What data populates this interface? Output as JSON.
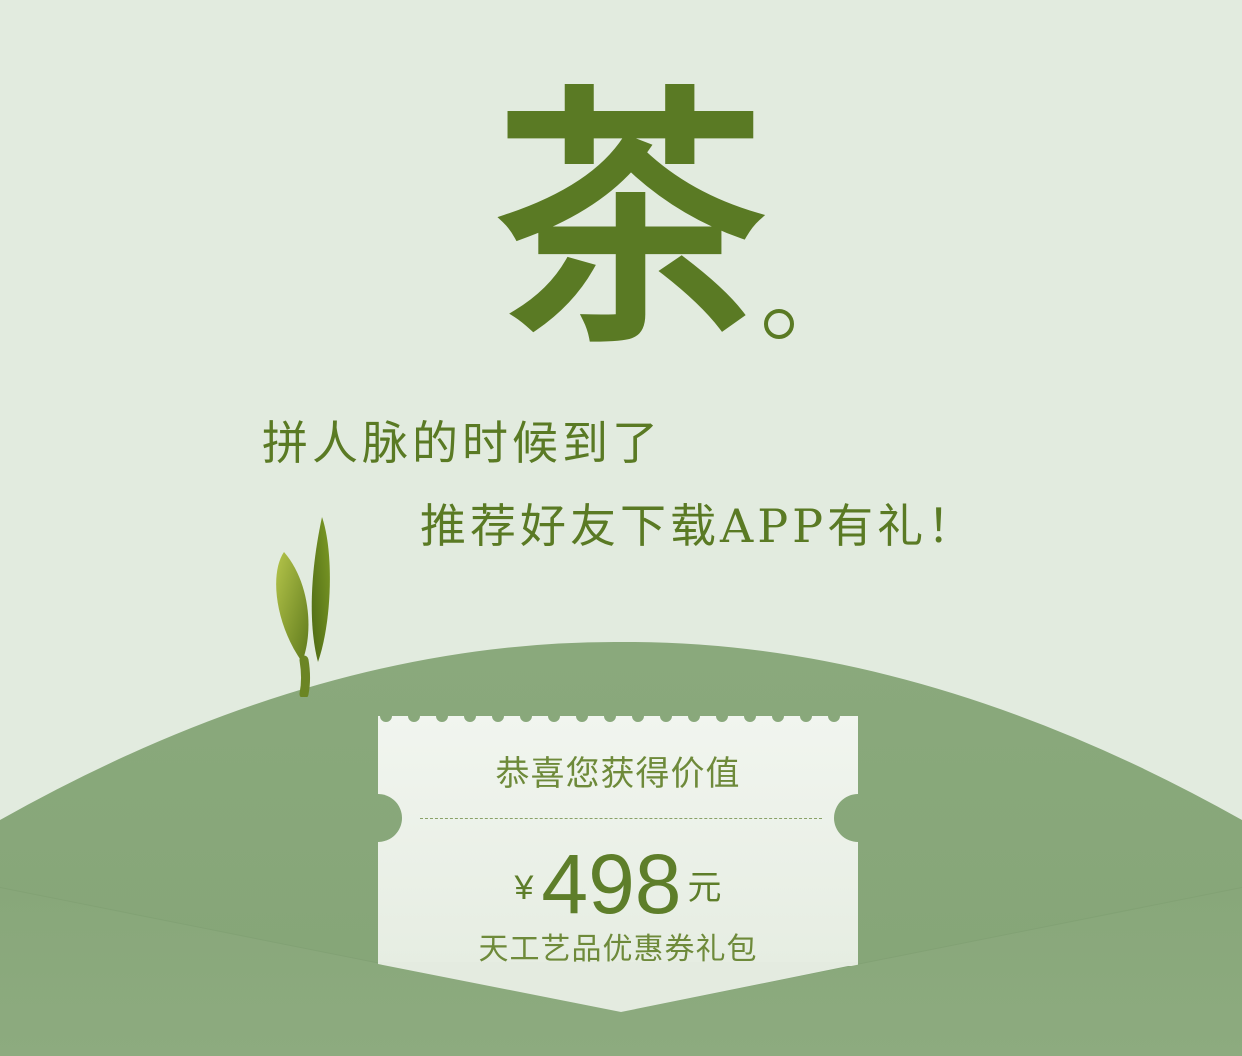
{
  "hero": {
    "character": "茶",
    "slogan_line1": "拼人脉的时候到了",
    "slogan_line2": "推荐好友下载APP有礼！"
  },
  "coupon": {
    "title": "恭喜您获得价值",
    "currency": "¥",
    "amount": "498",
    "unit": "元",
    "subtitle": "天工艺品优惠券礼包"
  },
  "colors": {
    "background": "#e2ebdf",
    "hill": "#8aa97c",
    "accent_green": "#5a7a24",
    "coupon_paper": "#eef3ec"
  },
  "icons": {
    "sprout": "tea-leaf-sprout-icon",
    "mark": "circle-period-icon"
  }
}
